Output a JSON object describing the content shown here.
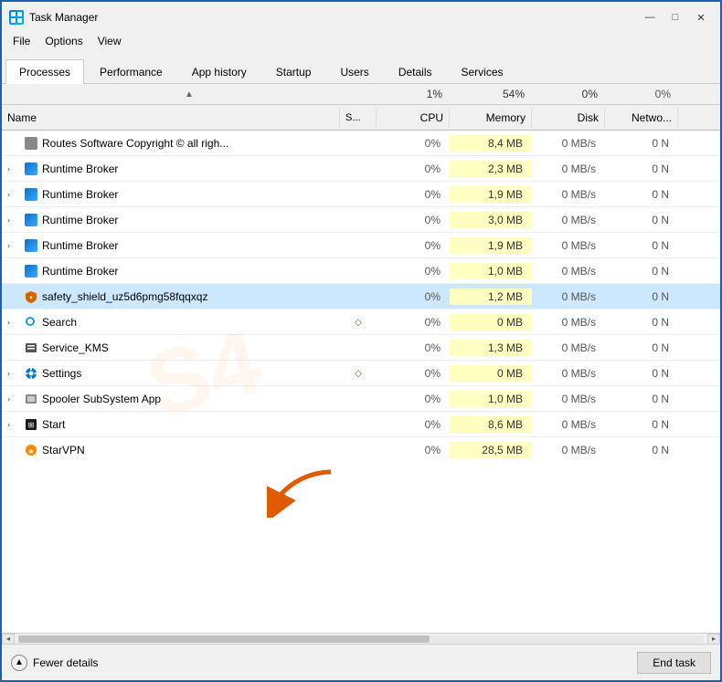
{
  "window": {
    "title": "Task Manager",
    "controls": {
      "minimize": "—",
      "maximize": "□",
      "close": "✕"
    }
  },
  "menu": {
    "items": [
      "File",
      "Options",
      "View"
    ]
  },
  "tabs": [
    {
      "label": "Processes",
      "active": true
    },
    {
      "label": "Performance",
      "active": false
    },
    {
      "label": "App history",
      "active": false
    },
    {
      "label": "Startup",
      "active": false
    },
    {
      "label": "Users",
      "active": false
    },
    {
      "label": "Details",
      "active": false
    },
    {
      "label": "Services",
      "active": false
    }
  ],
  "column_stats": {
    "cpu": "1%",
    "memory": "54%",
    "disk": "0%",
    "network": "0%"
  },
  "columns": {
    "name": "Name",
    "status": "S...",
    "cpu": "CPU",
    "memory": "Memory",
    "disk": "Disk",
    "network": "Netwo..."
  },
  "rows": [
    {
      "name": "Routes Software Copyright © all righ...",
      "icon": "routes",
      "expand": false,
      "status": "",
      "cpu": "0%",
      "memory": "8,4 MB",
      "disk": "0 MB/s",
      "network": "0 N",
      "selected": false,
      "highlighted": false
    },
    {
      "name": "Runtime Broker",
      "icon": "runtime",
      "expand": true,
      "status": "",
      "cpu": "0%",
      "memory": "2,3 MB",
      "disk": "0 MB/s",
      "network": "0 N",
      "selected": false,
      "highlighted": false
    },
    {
      "name": "Runtime Broker",
      "icon": "runtime",
      "expand": true,
      "status": "",
      "cpu": "0%",
      "memory": "1,9 MB",
      "disk": "0 MB/s",
      "network": "0 N",
      "selected": false,
      "highlighted": false
    },
    {
      "name": "Runtime Broker",
      "icon": "runtime",
      "expand": true,
      "status": "",
      "cpu": "0%",
      "memory": "3,0 MB",
      "disk": "0 MB/s",
      "network": "0 N",
      "selected": false,
      "highlighted": false
    },
    {
      "name": "Runtime Broker",
      "icon": "runtime",
      "expand": true,
      "status": "",
      "cpu": "0%",
      "memory": "1,9 MB",
      "disk": "0 MB/s",
      "network": "0 N",
      "selected": false,
      "highlighted": false
    },
    {
      "name": "Runtime Broker",
      "icon": "runtime",
      "expand": false,
      "status": "",
      "cpu": "0%",
      "memory": "1,0 MB",
      "disk": "0 MB/s",
      "network": "0 N",
      "selected": false,
      "highlighted": false
    },
    {
      "name": "safety_shield_uz5d6pmg58fqqxqz",
      "icon": "shield",
      "expand": false,
      "status": "",
      "cpu": "0%",
      "memory": "1,2 MB",
      "disk": "0 MB/s",
      "network": "0 N",
      "selected": true,
      "highlighted": false
    },
    {
      "name": "Search",
      "icon": "search",
      "expand": true,
      "status": "diamond",
      "cpu": "0%",
      "memory": "0 MB",
      "disk": "0 MB/s",
      "network": "0 N",
      "selected": false,
      "highlighted": false
    },
    {
      "name": "Service_KMS",
      "icon": "service",
      "expand": false,
      "status": "",
      "cpu": "0%",
      "memory": "1,3 MB",
      "disk": "0 MB/s",
      "network": "0 N",
      "selected": false,
      "highlighted": false
    },
    {
      "name": "Settings",
      "icon": "settings",
      "expand": true,
      "status": "diamond",
      "cpu": "0%",
      "memory": "0 MB",
      "disk": "0 MB/s",
      "network": "0 N",
      "selected": false,
      "highlighted": false
    },
    {
      "name": "Spooler SubSystem App",
      "icon": "spooler",
      "expand": true,
      "status": "",
      "cpu": "0%",
      "memory": "1,0 MB",
      "disk": "0 MB/s",
      "network": "0 N",
      "selected": false,
      "highlighted": false
    },
    {
      "name": "Start",
      "icon": "start",
      "expand": true,
      "status": "",
      "cpu": "0%",
      "memory": "8,6 MB",
      "disk": "0 MB/s",
      "network": "0 N",
      "selected": false,
      "highlighted": false
    },
    {
      "name": "StarVPN",
      "icon": "starvpn",
      "expand": false,
      "status": "",
      "cpu": "0%",
      "memory": "28,5 MB",
      "disk": "0 MB/s",
      "network": "0 N",
      "selected": false,
      "highlighted": false
    }
  ],
  "bottom": {
    "fewer_details": "Fewer details",
    "end_task": "End task"
  }
}
